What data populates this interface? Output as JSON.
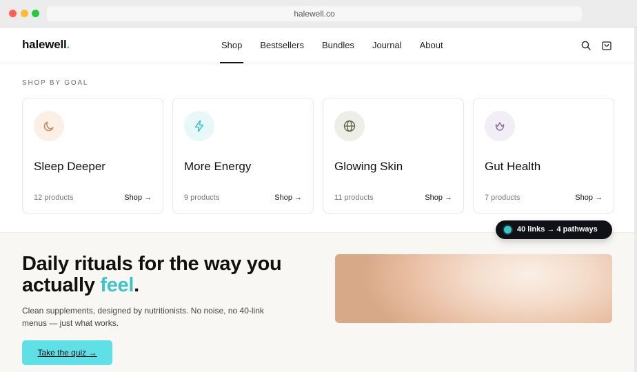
{
  "browser": {
    "url": "halewell.co"
  },
  "header": {
    "logo_text": "halewell",
    "logo_dot": ".",
    "nav": [
      {
        "label": "Shop",
        "active": true
      },
      {
        "label": "Bestsellers"
      },
      {
        "label": "Bundles"
      },
      {
        "label": "Journal"
      },
      {
        "label": "About"
      }
    ],
    "icons": [
      "search-icon",
      "cart-icon"
    ]
  },
  "goals": {
    "label": "SHOP BY GOAL",
    "cards": [
      {
        "title": "Sleep Deeper",
        "count": "12 products",
        "shop": "Shop →",
        "icon": "moon-icon",
        "tint": "#fbefe6",
        "color": "#c98a5a"
      },
      {
        "title": "More Energy",
        "count": "9 products",
        "shop": "Shop →",
        "icon": "bolt-icon",
        "tint": "#e8f8f9",
        "color": "#3cc4c8"
      },
      {
        "title": "Glowing Skin",
        "count": "11 products",
        "shop": "Shop →",
        "icon": "globe-icon",
        "tint": "#eeeee8",
        "color": "#5c6b4a"
      },
      {
        "title": "Gut Health",
        "count": "7 products",
        "shop": "Shop →",
        "icon": "tulip-icon",
        "tint": "#f2eef5",
        "color": "#8b6aa6"
      }
    ]
  },
  "hero": {
    "title_part1": "Daily rituals for the way you actually ",
    "title_accent": "feel",
    "title_end": ".",
    "description": "Clean supplements, designed by nutritionists. No noise, no 40-link menus — just what works.",
    "cta": "Take the quiz →"
  },
  "toast": {
    "text": "40 links → 4 pathways"
  },
  "colors": {
    "accent": "#3cc4c8",
    "cta": "#5fe0e6",
    "toast_bg": "#0f1116"
  }
}
